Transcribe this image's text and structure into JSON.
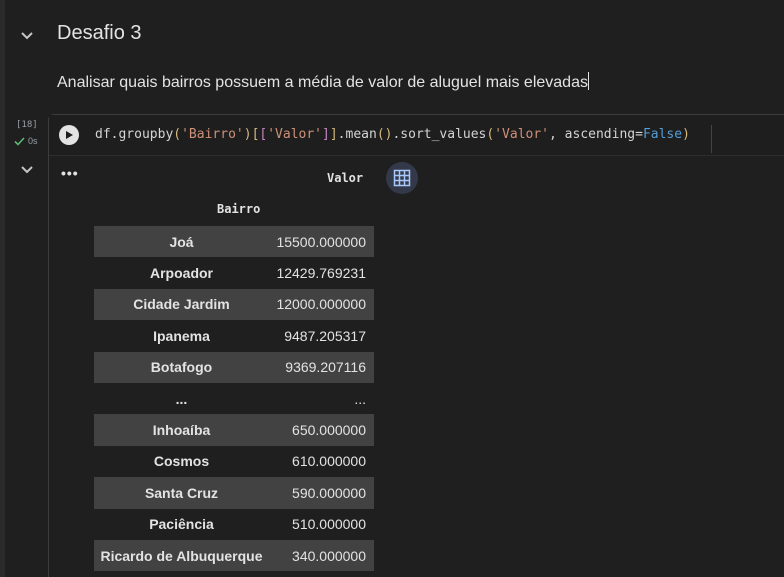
{
  "section": {
    "heading": "Desafio 3",
    "description": "Analisar quais bairros possuem a média de valor de aluguel mais elevadas"
  },
  "cell": {
    "execution_count": "[18]",
    "status_time": "0s",
    "code": {
      "t1": "df.groupby",
      "t2": "(",
      "t3": "'Bairro'",
      "t4": ")",
      "t5": "[",
      "t6": "[",
      "t7": "'Valor'",
      "t8": "]",
      "t9": "]",
      "t10": ".mean",
      "t11": "()",
      "t12": ".sort_values",
      "t13": "(",
      "t14": "'Valor'",
      "t15": ", ascending=",
      "t16": "False",
      "t17": ")"
    }
  },
  "output": {
    "dots": "•••",
    "column_header": "Valor",
    "index_name": "Bairro",
    "rows": [
      {
        "bairro": "Joá",
        "valor": "15500.000000"
      },
      {
        "bairro": "Arpoador",
        "valor": "12429.769231"
      },
      {
        "bairro": "Cidade Jardim",
        "valor": "12000.000000"
      },
      {
        "bairro": "Ipanema",
        "valor": "9487.205317"
      },
      {
        "bairro": "Botafogo",
        "valor": "9369.207116"
      },
      {
        "bairro": "...",
        "valor": "..."
      },
      {
        "bairro": "Inhoaíba",
        "valor": "650.000000"
      },
      {
        "bairro": "Cosmos",
        "valor": "610.000000"
      },
      {
        "bairro": "Santa Cruz",
        "valor": "590.000000"
      },
      {
        "bairro": "Paciência",
        "valor": "510.000000"
      },
      {
        "bairro": "Ricardo de Albuquerque",
        "valor": "340.000000"
      }
    ]
  },
  "icons": {
    "collapse": "chevron-down-icon",
    "run": "play-icon",
    "status": "check-icon",
    "table": "table-icon"
  },
  "colors": {
    "accent_check": "#5bb974",
    "string": "#ce9178",
    "keyword": "#569cd6"
  }
}
